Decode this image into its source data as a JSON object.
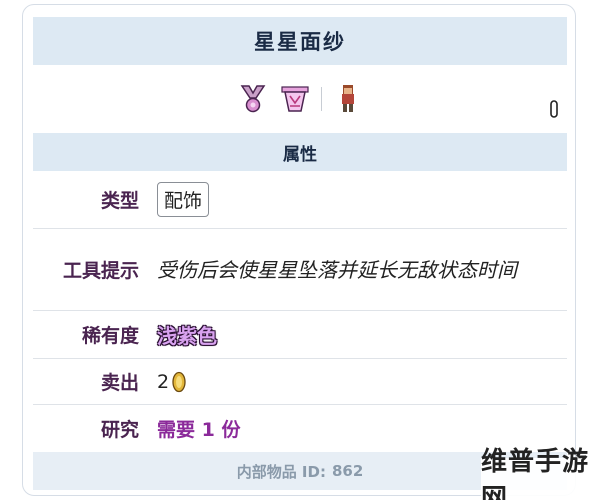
{
  "item": {
    "title": "星星面纱",
    "images": [
      "star-veil-sprite",
      "star-veil-equipped-sprite",
      "player-wearing-sprite"
    ]
  },
  "section": {
    "title": "属性"
  },
  "fields": {
    "type_label": "类型",
    "type_value": "配饰",
    "tooltip_label": "工具提示",
    "tooltip_value": "受伤后会使星星坠落并延长无敌状态时间",
    "rarity_label": "稀有度",
    "rarity_value": "浅紫色",
    "sell_label": "卖出",
    "sell_value": "2",
    "sell_coin": "gold-coin-icon",
    "research_label": "研究",
    "research_value": "需要 1 份"
  },
  "footer": {
    "label": "内部物品 ID:",
    "id": "862"
  },
  "watermark": {
    "text": "维普手游网"
  },
  "colors": {
    "header_bg": "#dde9f3",
    "label": "#4a2450",
    "rarity": "#d9a3f0",
    "research": "#8b2a9a"
  }
}
